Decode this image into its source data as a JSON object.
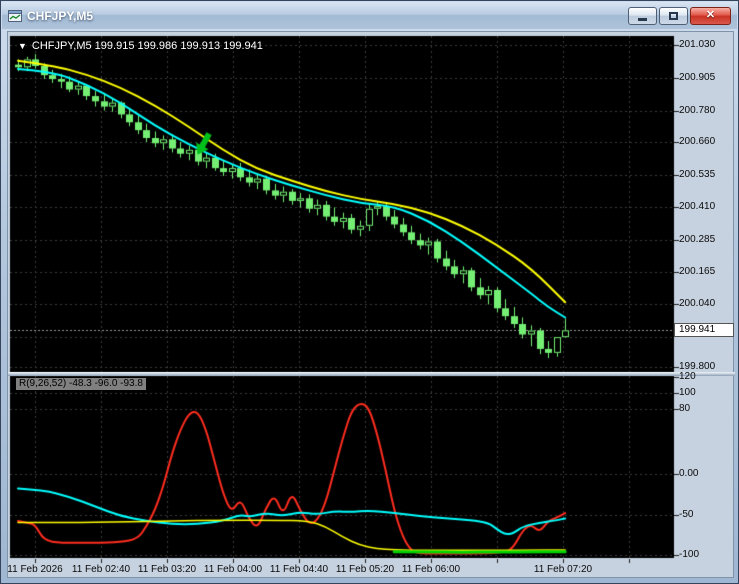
{
  "window": {
    "title": "CHFJPY,M5",
    "close_glyph": "✕"
  },
  "main_chart": {
    "collapse_glyph": "▼",
    "ohlc_label": "CHFJPY,M5 199.915 199.986 199.913 199.941",
    "open": "199.915",
    "high": "199.986",
    "low": "199.913",
    "close": "199.941",
    "current_price": "199.941"
  },
  "chart_data": {
    "type": "candlestick",
    "title": "CHFJPY,M5",
    "colors": {
      "background": "#000000",
      "grid": "#3a3a3a",
      "candle": "#74ef74",
      "bid_line": "#9a9a9a",
      "frame": "#c7d2e0"
    },
    "price_axis": {
      "ticks": [
        "201.030",
        "200.905",
        "200.780",
        "200.660",
        "200.535",
        "200.410",
        "200.285",
        "200.165",
        "200.040",
        "199.800"
      ],
      "tick_values": [
        201.03,
        200.905,
        200.78,
        200.66,
        200.535,
        200.41,
        200.285,
        200.165,
        200.04,
        199.8
      ],
      "extra_gridline": 199.915,
      "current_price": 199.941
    },
    "time_axis": {
      "labels": [
        "11 Feb 2026",
        "11 Feb 02:40",
        "11 Feb 03:20",
        "11 Feb 04:00",
        "11 Feb 04:40",
        "11 Feb 05:20",
        "11 Feb 06:00",
        "11 Feb 07:20"
      ],
      "slots": [
        0,
        1,
        2,
        3,
        4,
        5,
        6,
        8
      ],
      "gridline_slots": [
        0,
        1,
        2,
        3,
        4,
        5,
        6,
        7,
        8,
        9
      ]
    },
    "candles": [
      [
        200.955,
        200.975,
        200.93,
        200.945
      ],
      [
        200.945,
        200.985,
        200.93,
        200.975
      ],
      [
        200.975,
        200.995,
        200.94,
        200.95
      ],
      [
        200.95,
        200.96,
        200.9,
        200.915
      ],
      [
        200.915,
        200.935,
        200.885,
        200.9
      ],
      [
        200.9,
        200.92,
        200.865,
        200.89
      ],
      [
        200.89,
        200.91,
        200.85,
        200.86
      ],
      [
        200.86,
        200.89,
        200.84,
        200.875
      ],
      [
        200.875,
        200.88,
        200.82,
        200.835
      ],
      [
        200.835,
        200.855,
        200.795,
        200.815
      ],
      [
        200.815,
        200.84,
        200.78,
        200.795
      ],
      [
        200.795,
        200.825,
        200.775,
        200.81
      ],
      [
        200.81,
        200.815,
        200.75,
        200.765
      ],
      [
        200.765,
        200.79,
        200.72,
        200.735
      ],
      [
        200.735,
        200.76,
        200.69,
        200.705
      ],
      [
        200.705,
        200.73,
        200.66,
        200.675
      ],
      [
        200.675,
        200.7,
        200.64,
        200.655
      ],
      [
        200.655,
        200.685,
        200.63,
        200.67
      ],
      [
        200.67,
        200.69,
        200.62,
        200.635
      ],
      [
        200.635,
        200.66,
        200.6,
        200.615
      ],
      [
        200.615,
        200.645,
        200.59,
        200.63
      ],
      [
        200.63,
        200.65,
        200.57,
        200.585
      ],
      [
        200.585,
        200.62,
        200.56,
        200.6
      ],
      [
        200.6,
        200.615,
        200.55,
        200.56
      ],
      [
        200.56,
        200.59,
        200.53,
        200.545
      ],
      [
        200.545,
        200.575,
        200.52,
        200.56
      ],
      [
        200.56,
        200.58,
        200.51,
        200.525
      ],
      [
        200.525,
        200.555,
        200.49,
        200.505
      ],
      [
        200.505,
        200.54,
        200.48,
        200.52
      ],
      [
        200.52,
        200.53,
        200.46,
        200.475
      ],
      [
        200.475,
        200.5,
        200.44,
        200.455
      ],
      [
        200.455,
        200.49,
        200.43,
        200.47
      ],
      [
        200.47,
        200.48,
        200.42,
        200.435
      ],
      [
        200.435,
        200.465,
        200.41,
        200.445
      ],
      [
        200.445,
        200.46,
        200.39,
        200.405
      ],
      [
        200.405,
        200.44,
        200.38,
        200.42
      ],
      [
        200.42,
        200.435,
        200.36,
        200.375
      ],
      [
        200.375,
        200.41,
        200.34,
        200.355
      ],
      [
        200.355,
        200.39,
        200.33,
        200.37
      ],
      [
        200.37,
        200.385,
        200.31,
        200.325
      ],
      [
        200.325,
        200.36,
        200.3,
        200.34
      ],
      [
        200.34,
        200.42,
        200.32,
        200.405
      ],
      [
        200.405,
        200.43,
        200.38,
        200.415
      ],
      [
        200.415,
        200.425,
        200.36,
        200.375
      ],
      [
        200.375,
        200.4,
        200.33,
        200.345
      ],
      [
        200.345,
        200.37,
        200.3,
        200.315
      ],
      [
        200.315,
        200.34,
        200.27,
        200.285
      ],
      [
        200.285,
        200.31,
        200.25,
        200.265
      ],
      [
        200.265,
        200.295,
        200.23,
        200.28
      ],
      [
        200.28,
        200.29,
        200.2,
        200.215
      ],
      [
        200.215,
        200.245,
        200.17,
        200.185
      ],
      [
        200.185,
        200.21,
        200.14,
        200.155
      ],
      [
        200.155,
        200.185,
        200.12,
        200.17
      ],
      [
        200.17,
        200.18,
        200.09,
        200.105
      ],
      [
        200.105,
        200.14,
        200.06,
        200.075
      ],
      [
        200.075,
        200.11,
        200.04,
        200.095
      ],
      [
        200.095,
        200.105,
        200.01,
        200.025
      ],
      [
        200.025,
        200.06,
        199.98,
        199.995
      ],
      [
        199.995,
        200.03,
        199.95,
        199.965
      ],
      [
        199.965,
        199.99,
        199.91,
        199.925
      ],
      [
        199.925,
        199.96,
        199.88,
        199.94
      ],
      [
        199.94,
        199.95,
        199.85,
        199.87
      ],
      [
        199.87,
        199.9,
        199.835,
        199.855
      ],
      [
        199.855,
        199.915,
        199.84,
        199.915
      ],
      [
        199.915,
        199.986,
        199.913,
        199.941
      ]
    ],
    "overlays": [
      {
        "name": "ma-yellow",
        "color": "#ffff00",
        "width": 2,
        "points": [
          [
            0,
            200.97
          ],
          [
            4,
            200.952
          ],
          [
            8,
            200.918
          ],
          [
            12,
            200.868
          ],
          [
            16,
            200.8
          ],
          [
            20,
            200.718
          ],
          [
            24,
            200.628
          ],
          [
            28,
            200.556
          ],
          [
            32,
            200.512
          ],
          [
            36,
            200.472
          ],
          [
            40,
            200.442
          ],
          [
            44,
            200.424
          ],
          [
            48,
            200.392
          ],
          [
            52,
            200.34
          ],
          [
            56,
            200.268
          ],
          [
            60,
            200.178
          ],
          [
            64,
            200.048
          ]
        ]
      },
      {
        "name": "ma-cyan",
        "color": "#00ffff",
        "width": 2,
        "points": [
          [
            0,
            200.938
          ],
          [
            4,
            200.928
          ],
          [
            8,
            200.88
          ],
          [
            12,
            200.81
          ],
          [
            16,
            200.722
          ],
          [
            20,
            200.65
          ],
          [
            24,
            200.588
          ],
          [
            28,
            200.536
          ],
          [
            32,
            200.494
          ],
          [
            36,
            200.456
          ],
          [
            40,
            200.426
          ],
          [
            44,
            200.414
          ],
          [
            48,
            200.36
          ],
          [
            52,
            200.278
          ],
          [
            56,
            200.18
          ],
          [
            60,
            200.082
          ],
          [
            62,
            200.03
          ],
          [
            64,
            199.99
          ]
        ]
      }
    ],
    "marker": {
      "type": "arrow",
      "direction": "down-left",
      "color": "#00c11c",
      "index": 21,
      "price": 200.6
    },
    "indicator": {
      "name": "R(9,26,52)",
      "label": "R(9,26,52) -48.3 -96.0 -93.8",
      "values": [
        "-48.3",
        "-96.0",
        "-93.8"
      ],
      "scale_ticks": [
        {
          "label": "120",
          "value": 120
        },
        {
          "label": "100",
          "value": 100
        },
        {
          "label": "80",
          "value": 80
        },
        {
          "label": "0.00",
          "value": 0
        },
        {
          "label": "-50",
          "value": -50
        },
        {
          "label": "-100",
          "value": -100
        }
      ],
      "gridline_values": [
        100,
        80,
        0,
        -50,
        -100
      ],
      "series": [
        {
          "name": "signal-red",
          "color": "#ff2d20",
          "width": 2,
          "points": [
            [
              0,
              -58
            ],
            [
              1,
              -60
            ],
            [
              2,
              -62
            ],
            [
              3,
              -82
            ],
            [
              5,
              -85
            ],
            [
              9,
              -85
            ],
            [
              12,
              -84
            ],
            [
              14,
              -80
            ],
            [
              15,
              -65
            ],
            [
              16,
              -45
            ],
            [
              17,
              -15
            ],
            [
              18,
              25
            ],
            [
              19,
              55
            ],
            [
              20,
              75
            ],
            [
              21,
              78
            ],
            [
              22,
              55
            ],
            [
              23,
              15
            ],
            [
              24,
              -25
            ],
            [
              25,
              -48
            ],
            [
              26,
              -30
            ],
            [
              27,
              -55
            ],
            [
              28,
              -68
            ],
            [
              29,
              -42
            ],
            [
              30,
              -25
            ],
            [
              31,
              -52
            ],
            [
              32,
              -22
            ],
            [
              33,
              -45
            ],
            [
              34,
              -62
            ],
            [
              35,
              -58
            ],
            [
              36,
              -35
            ],
            [
              37,
              5
            ],
            [
              38,
              45
            ],
            [
              39,
              78
            ],
            [
              40,
              88
            ],
            [
              41,
              83
            ],
            [
              42,
              50
            ],
            [
              43,
              5
            ],
            [
              44,
              -45
            ],
            [
              45,
              -78
            ],
            [
              46,
              -95
            ],
            [
              47,
              -98
            ],
            [
              50,
              -98
            ],
            [
              54,
              -98
            ],
            [
              57,
              -97
            ],
            [
              58,
              -90
            ],
            [
              59,
              -70
            ],
            [
              60,
              -62
            ],
            [
              61,
              -72
            ],
            [
              62,
              -58
            ],
            [
              63,
              -54
            ],
            [
              64,
              -48.3
            ]
          ]
        },
        {
          "name": "line-cyan",
          "color": "#00ffff",
          "width": 2,
          "points": [
            [
              0,
              -18
            ],
            [
              3,
              -20
            ],
            [
              6,
              -28
            ],
            [
              9,
              -40
            ],
            [
              12,
              -52
            ],
            [
              15,
              -58
            ],
            [
              18,
              -62
            ],
            [
              21,
              -62
            ],
            [
              24,
              -58
            ],
            [
              26,
              -50
            ],
            [
              27,
              -53
            ],
            [
              29,
              -48
            ],
            [
              31,
              -52
            ],
            [
              33,
              -47
            ],
            [
              35,
              -50
            ],
            [
              37,
              -46
            ],
            [
              39,
              -47
            ],
            [
              41,
              -45
            ],
            [
              44,
              -48
            ],
            [
              47,
              -52
            ],
            [
              50,
              -55
            ],
            [
              53,
              -57
            ],
            [
              55,
              -60
            ],
            [
              56,
              -68
            ],
            [
              57,
              -75
            ],
            [
              58,
              -73
            ],
            [
              59,
              -65
            ],
            [
              61,
              -60
            ],
            [
              63,
              -57
            ],
            [
              64,
              -55
            ]
          ]
        },
        {
          "name": "line-yellow",
          "color": "#ffff00",
          "width": 1.5,
          "points": [
            [
              0,
              -60
            ],
            [
              6,
              -60
            ],
            [
              12,
              -59
            ],
            [
              18,
              -58
            ],
            [
              24,
              -57
            ],
            [
              30,
              -57
            ],
            [
              34,
              -58
            ],
            [
              36,
              -65
            ],
            [
              38,
              -78
            ],
            [
              40,
              -88
            ],
            [
              42,
              -92
            ],
            [
              44,
              -94
            ],
            [
              48,
              -94
            ],
            [
              52,
              -94
            ],
            [
              56,
              -94
            ],
            [
              60,
              -94
            ],
            [
              64,
              -93.8
            ]
          ]
        },
        {
          "name": "line-lime",
          "color": "#00d400",
          "width": 3,
          "points": [
            [
              44,
              -96
            ],
            [
              48,
              -96.4
            ],
            [
              52,
              -96.5
            ],
            [
              56,
              -96.4
            ],
            [
              60,
              -96.2
            ],
            [
              64,
              -96.0
            ]
          ]
        }
      ]
    }
  }
}
